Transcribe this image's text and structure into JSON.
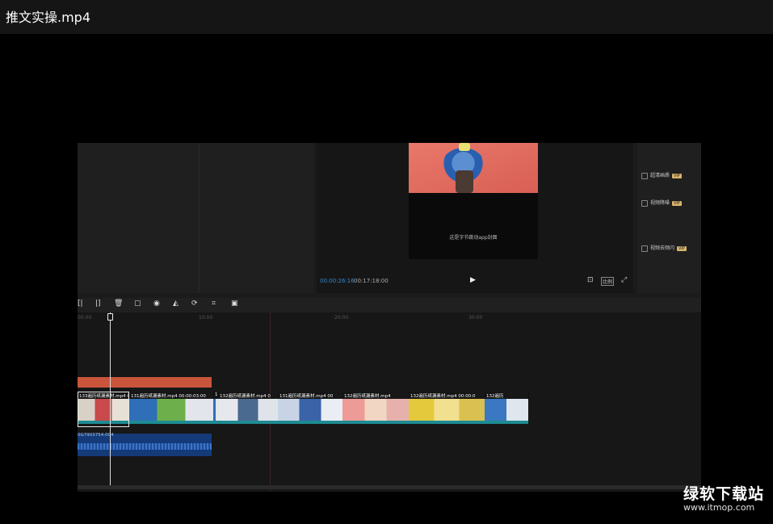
{
  "window": {
    "title": "推文实操.mp4"
  },
  "preview": {
    "subtitle": "这是字节跳动app封面",
    "current_time": "00:00:26:16",
    "duration": "00:17:18:00",
    "play_icon": "▶",
    "ratio_label": "比例"
  },
  "properties": [
    {
      "label": "超清画质",
      "badge": "VIP"
    },
    {
      "label": "视频降噪",
      "badge": "VIP"
    },
    {
      "label": "视频去频闪",
      "badge": "VIP"
    }
  ],
  "toolbar": {
    "icons": [
      "split-left-icon",
      "split-right-icon",
      "delete-icon",
      "freeze-icon",
      "speed-icon",
      "mirror-icon",
      "rotate-icon",
      "crop-icon",
      "image-icon"
    ],
    "glyphs": [
      "[|",
      "|]",
      "🗑",
      "▢",
      "◉",
      "◭",
      "⟳",
      "⌗",
      "▣"
    ]
  },
  "timeline": {
    "ruler": [
      "00:00",
      "10:00",
      "20:00",
      "30:00"
    ],
    "audio_label": "0G7903754:004",
    "clips": [
      {
        "label": "133遍历纸漏素材.mp4  00:0",
        "colors": [
          "#d8d2c6",
          "#c84a4a",
          "#e7e0d6"
        ]
      },
      {
        "label": "131遍历纸漏素材.mp4  00:00:03:00",
        "colors": [
          "#2f6fb8",
          "#6db04b",
          "#e2e6ec"
        ]
      },
      {
        "label": "1",
        "colors": [
          "#2f6fb8",
          "#e2e6ec"
        ]
      },
      {
        "label": "132遍历纸漏素材.mp4  0",
        "colors": [
          "#e7e8ee",
          "#4a6a90",
          "#dfe4ea"
        ]
      },
      {
        "label": "131遍历纸漏素材.mp4  00",
        "colors": [
          "#c8d4e6",
          "#3a63a8",
          "#e9eef4"
        ]
      },
      {
        "label": "132遍历纸漏素材.mp4",
        "colors": [
          "#ee9a96",
          "#f2d6c4",
          "#e6b0ac"
        ]
      },
      {
        "label": "132遍历纸漏素材.mp4  00:00:0",
        "colors": [
          "#e4c93c",
          "#f0e090",
          "#dac050"
        ]
      },
      {
        "label": "132遍历",
        "colors": [
          "#3b78c2",
          "#e0e6ee"
        ]
      }
    ]
  },
  "watermark": {
    "site": "绿软下载站",
    "url": "www.itmop.com"
  }
}
